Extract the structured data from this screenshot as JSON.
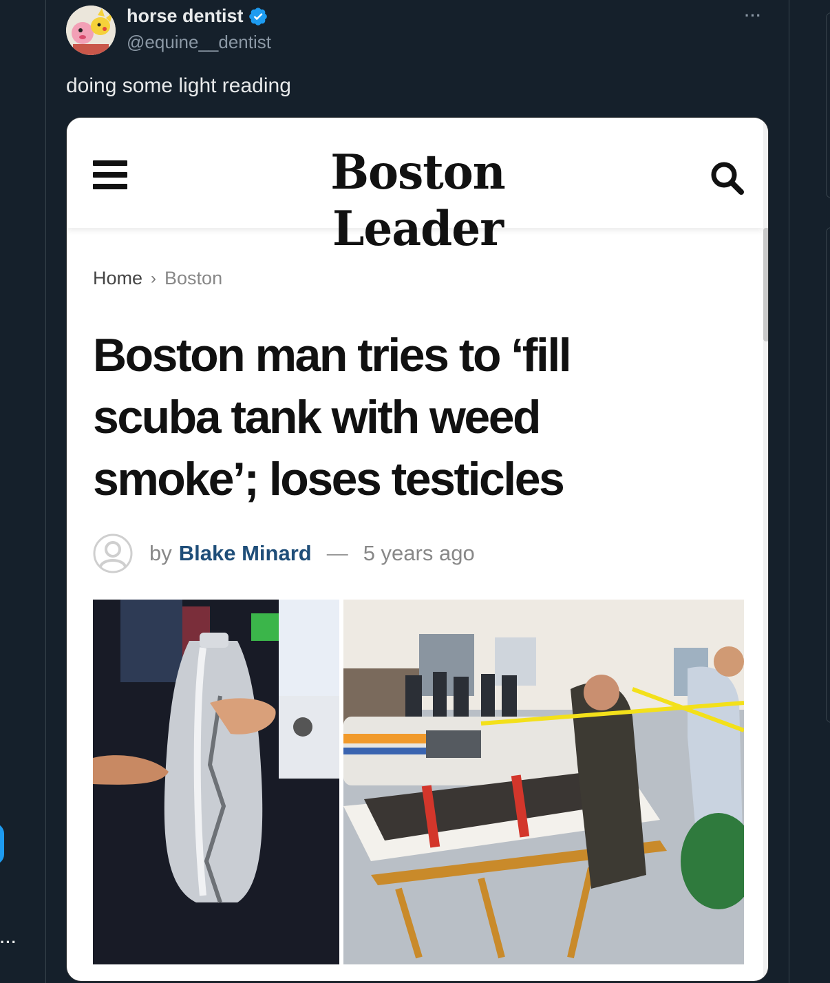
{
  "tweet": {
    "author_name": "horse dentist",
    "author_handle": "@equine__dentist",
    "more_label": "···",
    "text": "doing some light reading",
    "verified_color": "#1d9bf0"
  },
  "sidebar": {
    "more_label": "···"
  },
  "article": {
    "site_name": "Boston Leader",
    "breadcrumb": {
      "home": "Home",
      "separator": "›",
      "current": "Boston"
    },
    "headline": "Boston man tries to ‘fill scuba tank with weed smoke’; loses testicles",
    "byline": {
      "by": "by",
      "author": "Blake Minard",
      "dash": "—",
      "age": "5 years ago"
    },
    "photos": [
      {
        "subject": "ruptured scuba tank held by hands"
      },
      {
        "subject": "man on stretcher being loaded into ambulance by paramedics"
      }
    ]
  },
  "colors": {
    "background": "#15202b",
    "text_primary": "#e7e9ea",
    "text_secondary": "#8b98a5",
    "accent": "#1d9bf0",
    "byline_author": "#1f4e79"
  }
}
